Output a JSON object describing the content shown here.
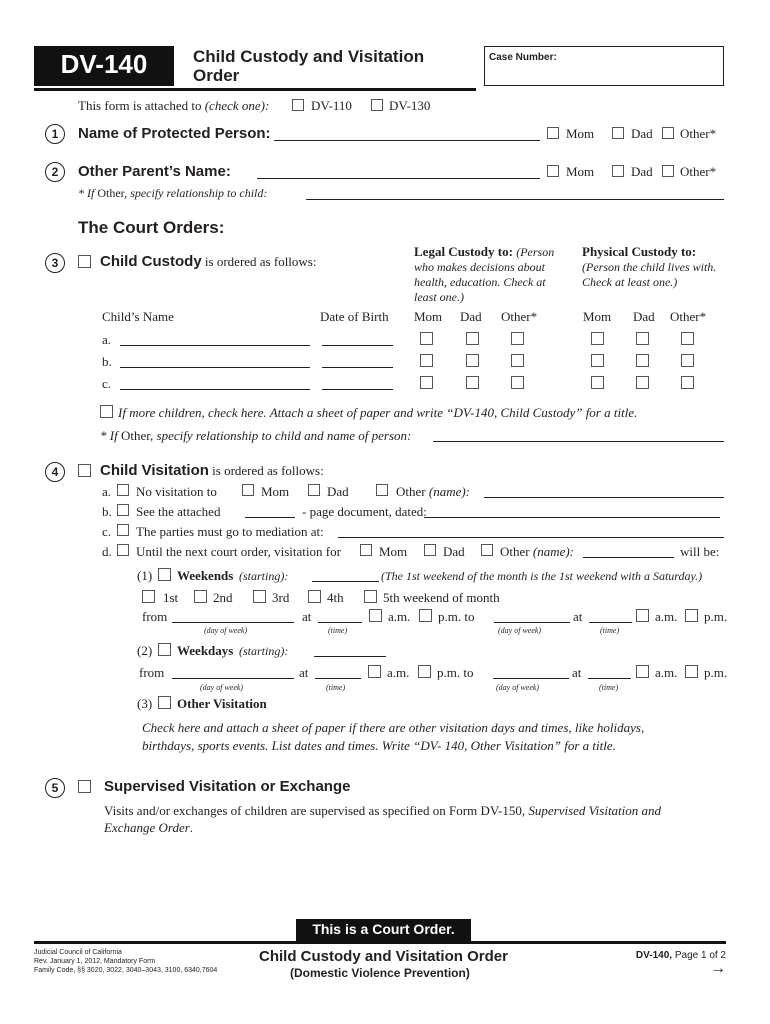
{
  "header": {
    "form_id": "DV-140",
    "title_line1": "Child Custody and Visitation",
    "title_line2": "Order",
    "case_number_label": "Case Number:",
    "case_number_value": ""
  },
  "attached": {
    "label_prefix": "This form is attached to ",
    "label_italic": "(check one):",
    "options": [
      "DV-110",
      "DV-130"
    ]
  },
  "item1": {
    "number": "1",
    "label": "Name of Protected Person:",
    "value": "",
    "options": [
      "Mom",
      "Dad",
      "Other*"
    ]
  },
  "item2": {
    "number": "2",
    "label": "Other Parent’s Name:",
    "value": "",
    "options": [
      "Mom",
      "Dad",
      "Other*"
    ],
    "other_note_a": "* If",
    "other_note_b": " Other,",
    "other_note_c": " specify relationship to child:",
    "other_value": ""
  },
  "court_orders_heading": "The Court Orders:",
  "item3": {
    "number": "3",
    "label_bold": "Child Custody",
    "label_rest": " is ordered as follows:",
    "legal_heading": "Legal Custody to:",
    "legal_note_1": "(Person",
    "legal_note_2": "who makes decisions about",
    "legal_note_3": "health, education. Check at",
    "legal_note_4": "least one.)",
    "physical_heading": "Physical Custody to:",
    "physical_note_1": "(Person the child lives with.",
    "physical_note_2": "Check at least one.)",
    "col_child": "Child’s Name",
    "col_dob": "Date of Birth",
    "legal_cols": [
      "Mom",
      "Dad",
      "Other*"
    ],
    "physical_cols": [
      "Mom",
      "Dad",
      "Other*"
    ],
    "rows": [
      {
        "letter": "a.",
        "name": "",
        "dob": ""
      },
      {
        "letter": "b.",
        "name": "",
        "dob": ""
      },
      {
        "letter": "c.",
        "name": "",
        "dob": ""
      }
    ],
    "more_children": "If more children, check here. Attach a sheet of paper and write “DV-140, Child Custody” for a title.",
    "other_note_a": "* If",
    "other_note_b": " Other,",
    "other_note_c": " specify relationship to child and name of person:",
    "other_value": ""
  },
  "item4": {
    "number": "4",
    "label_bold": "Child Visitation",
    "label_rest": " is ordered as follows:",
    "a": {
      "letter": "a.",
      "text": "No visitation to",
      "options": [
        "Mom",
        "Dad",
        "Other"
      ],
      "name_label": "(name):",
      "name_value": ""
    },
    "b": {
      "letter": "b.",
      "text": "See the attached",
      "pages_value": "",
      "text2": "- page document, dated:",
      "date_value": ""
    },
    "c": {
      "letter": "c.",
      "text": "The parties must go to mediation at:",
      "value": ""
    },
    "d": {
      "letter": "d.",
      "text": "Until the next court order, visitation for",
      "options": [
        "Mom",
        "Dad",
        "Other"
      ],
      "name_label": "(name):",
      "name_value": "",
      "will_be": "will be:"
    },
    "weekends": {
      "num": "(1)",
      "label": "Weekends",
      "starting": "(starting):",
      "starting_value": "",
      "note": "(The 1st weekend of the month is the 1st weekend with a Saturday.)",
      "weeks": [
        "1st",
        "2nd",
        "3rd",
        "4th",
        "5th weekend of month"
      ],
      "from": "from",
      "at": "at",
      "am": "a.m.",
      "pm_to": "p.m. to",
      "pm": "p.m.",
      "cap_day": "(day of week)",
      "cap_time": "(time)"
    },
    "weekdays": {
      "num": "(2)",
      "label": "Weekdays",
      "starting": "(starting):",
      "starting_value": "",
      "from": "from",
      "at": "at",
      "am": "a.m.",
      "pm_to": "p.m. to",
      "pm": "p.m.",
      "cap_day": "(day of week)",
      "cap_time": "(time)"
    },
    "other_visitation": {
      "num": "(3)",
      "label": "Other Visitation",
      "note_1": "Check here and attach a sheet of paper if there are other visitation days and times, like holidays,",
      "note_2": "birthdays, sports events. List dates and times. Write “DV- 140, Other Visitation” for a title."
    }
  },
  "item5": {
    "number": "5",
    "label": "Supervised Visitation or Exchange",
    "text_1a": "Visits and/or exchanges of children are supervised as specified on Form DV-150, ",
    "text_1b": "Supervised Visitation and",
    "text_2": "Exchange Order",
    "text_2b": "."
  },
  "footer": {
    "court_order_banner": "This is a Court Order.",
    "left_1": "Judicial Council of California",
    "left_2": "Rev. January 1, 2012, Mandatory Form",
    "left_3": "Family Code, §§ 3020, 3022, 3040–3043, 3100, 6340,7604",
    "center_title": "Child Custody and Visitation Order",
    "center_subtitle": "(Domestic Violence Prevention)",
    "right_form": "DV-140,",
    "right_page": " Page 1 of 2",
    "next_arrow": "→"
  }
}
